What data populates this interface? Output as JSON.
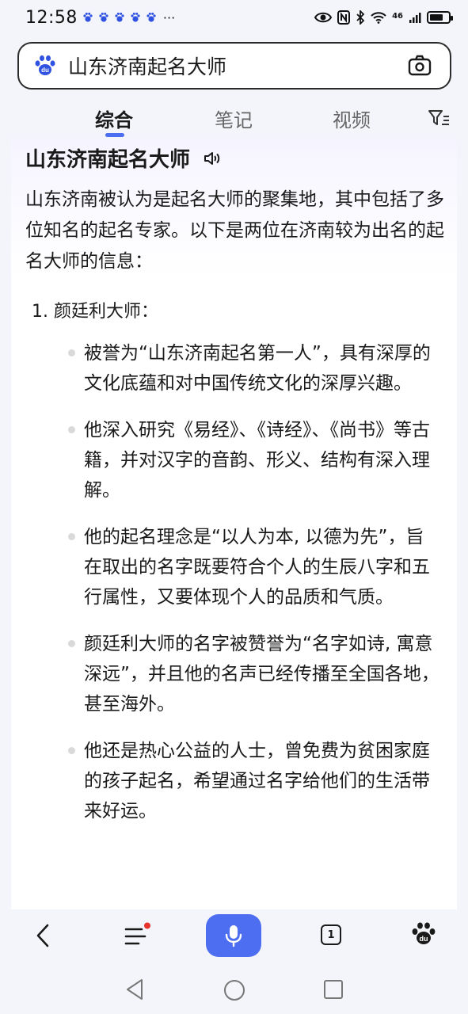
{
  "status_bar": {
    "time": "12:58",
    "dots": "···",
    "network": "46",
    "icons": [
      "baidu-notification-icon",
      "eye-icon",
      "nfc-icon",
      "bluetooth-icon",
      "wifi-icon",
      "signal-icon",
      "battery-icon"
    ]
  },
  "search": {
    "query": "山东济南起名大师",
    "logo_icon": "baidu-paw-icon",
    "camera_icon": "camera-icon"
  },
  "tabs": [
    {
      "label": "综合",
      "active": true
    },
    {
      "label": "笔记",
      "active": false
    },
    {
      "label": "视频",
      "active": false
    }
  ],
  "content": {
    "heading": "山东济南起名大师",
    "intro": "山东济南被认为是起名大师的聚集地，其中包括了多位知名的起名专家。以下是两位在济南较为出名的起名大师的信息：",
    "list_title": "1. 颜廷利大师：",
    "bullets": [
      "被誉为“山东济南起名第一人”，具有深厚的文化底蕴和对中国传统文化的深厚兴趣。",
      "他深入研究《易经》、《诗经》、《尚书》等古籍，并对汉字的音韵、形义、结构有深入理解。",
      "他的起名理念是“以人为本, 以德为先”，旨在取出的名字既要符合个人的生辰八字和五行属性，又要体现个人的品质和气质。",
      "颜廷利大师的名字被赞誉为“名字如诗, 寓意深远”，并且他的名声已经传播至全国各地，甚至海外。",
      "他还是热心公益的人士，曾免费为贫困家庭的孩子起名，希望通过名字给他们的生活带来好运。"
    ]
  },
  "bottom_bar": {
    "tab_count": "1",
    "accent": "#4e6ef2",
    "notification_dot": "#e8332c"
  }
}
